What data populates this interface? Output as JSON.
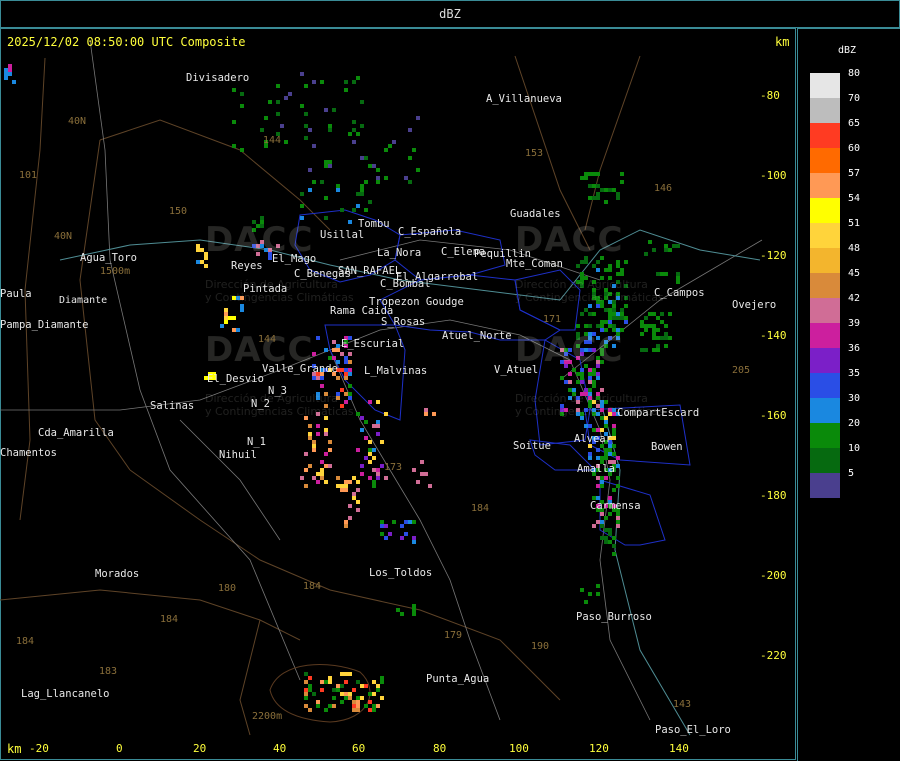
{
  "window": {
    "title": "dBZ"
  },
  "header": {
    "timestamp": "2025/12/02 08:50:00 UTC Composite",
    "unit_top": "km",
    "unit_bottom": "km"
  },
  "axes": {
    "x_ticks": [
      "-20",
      "0",
      "20",
      "40",
      "60",
      "80",
      "100",
      "120",
      "140"
    ],
    "y_ticks": [
      "-80",
      "-100",
      "-120",
      "-140",
      "-160",
      "-180",
      "-200",
      "-220"
    ]
  },
  "legend": {
    "title": "dBZ",
    "levels": [
      {
        "label": "80",
        "color": "#e6e6e6"
      },
      {
        "label": "70",
        "color": "#bdbdbd"
      },
      {
        "label": "65",
        "color": "#ff3b22"
      },
      {
        "label": "60",
        "color": "#ff6a00"
      },
      {
        "label": "57",
        "color": "#ff9955"
      },
      {
        "label": "54",
        "color": "#ffff00"
      },
      {
        "label": "51",
        "color": "#ffd43b"
      },
      {
        "label": "48",
        "color": "#f3b52d"
      },
      {
        "label": "45",
        "color": "#d98a3a"
      },
      {
        "label": "42",
        "color": "#d06d96"
      },
      {
        "label": "39",
        "color": "#cc1f9e"
      },
      {
        "label": "36",
        "color": "#7b1fc8"
      },
      {
        "label": "35",
        "color": "#2a4ee6"
      },
      {
        "label": "30",
        "color": "#1a88e0"
      },
      {
        "label": "20",
        "color": "#0a8a0a"
      },
      {
        "label": "10",
        "color": "#066a10"
      },
      {
        "label": "5",
        "color": "#4a3f8e"
      }
    ]
  },
  "places": [
    "Divisadero",
    "A_Villanueva",
    "Usillal",
    "Tombu",
    "C_Española",
    "La_Nora",
    "C_Elena",
    "Pequillin",
    "Mte_Coman",
    "Agua_Toro",
    "Reyes",
    "El_Mago",
    "C_Benegas",
    "SAN_RAFAEL",
    "El_Algarrobal",
    "C_Bombal",
    "Pintada",
    "Rama Caida",
    "S_Rosas",
    "Tropezon Goudge",
    "Atuel_Norte",
    "Guadales",
    "C_Campos",
    "Ovejero",
    "Pampa_Diamante",
    "E_Escurial",
    "Valle_Grande",
    "L_Malvinas",
    "El_Desvio",
    "V_Atuel",
    "Salinas",
    "CompartEscard",
    "Cda_Amarilla",
    "N_1",
    "N_2",
    "N_3",
    "Nihuil",
    "Soitue",
    "Bowen",
    "Monte_Comán",
    "Amalla",
    "Alvear",
    "Carmensa",
    "Los_Toldos",
    "Morados",
    "Paso_Burroso",
    "Punta_Agua",
    "Lag_Llancanelo",
    "Paso_El_Loro",
    "Agua_Toro",
    "Diamante",
    "Chamentos",
    "Paula"
  ],
  "routes": [
    "101",
    "40N",
    "144",
    "143",
    "150",
    "153",
    "146",
    "40N",
    "144",
    "171",
    "205",
    "173",
    "184",
    "180",
    "184",
    "179",
    "190",
    "183",
    "184",
    "143"
  ],
  "elevations": [
    "1500m",
    "2200m"
  ],
  "watermark": {
    "brand": "DACC",
    "line1": "Dirección de Agricultura",
    "line2": "y Contingencias Climáticas"
  },
  "colors": {
    "frame": "#3a8b96",
    "axis_text": "#ffff3c",
    "province_border": "#6b4a2a",
    "district_border": "#1e30c8",
    "river": "#5a9aa0",
    "road": "#8c8c8c"
  }
}
